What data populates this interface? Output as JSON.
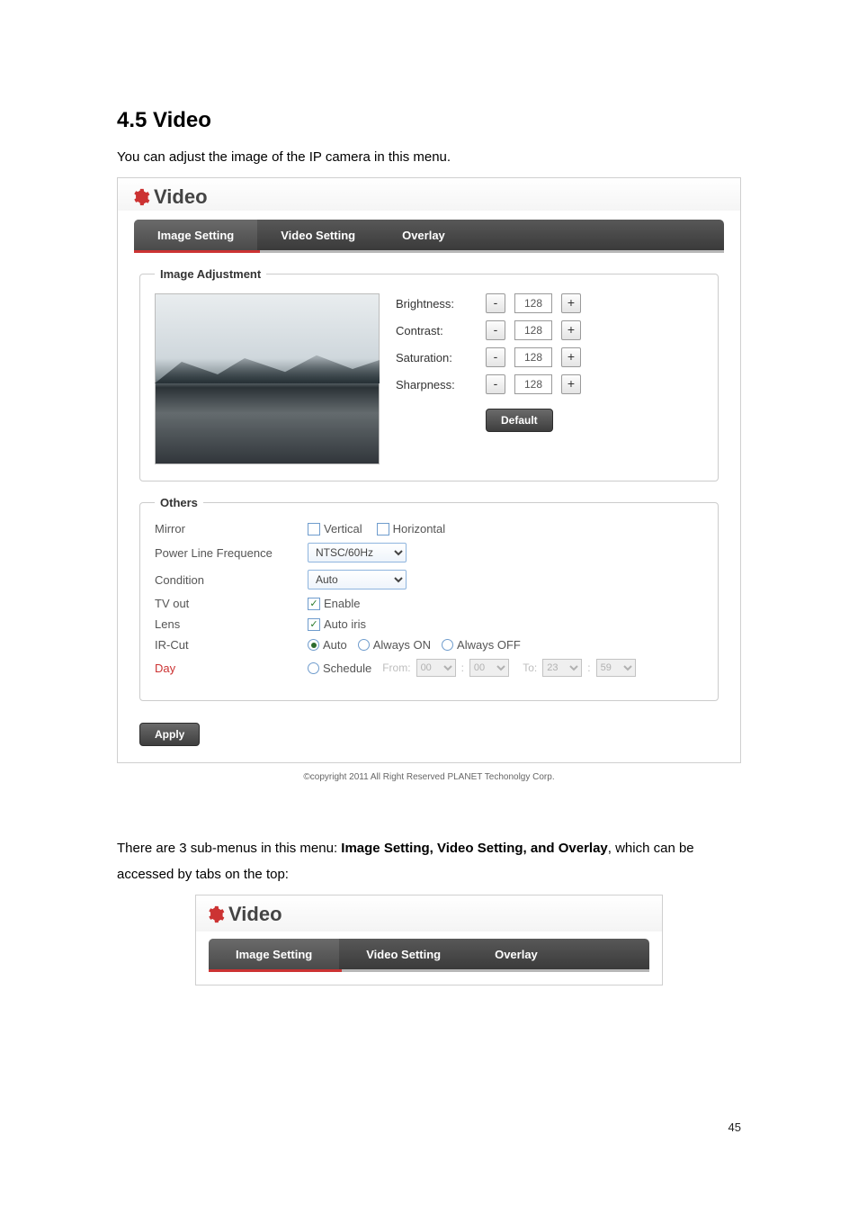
{
  "page": {
    "heading": "4.5 Video",
    "intro": "You can adjust the image of the IP camera in this menu.",
    "body_text_pre": "There are 3 sub-menus in this menu: ",
    "body_text_bold": "Image Setting, Video Setting, and Overlay",
    "body_text_post": ", which can be accessed by tabs on the top:",
    "page_number": "45",
    "copyright": "©copyright 2011 All Right Reserved PLANET Techonolgy Corp."
  },
  "video_panel": {
    "title": "Video",
    "tabs": [
      "Image Setting",
      "Video Setting",
      "Overlay"
    ],
    "active_tab": 0,
    "image_adjustment": {
      "legend": "Image Adjustment",
      "items": [
        {
          "label": "Brightness:",
          "value": "128"
        },
        {
          "label": "Contrast:",
          "value": "128"
        },
        {
          "label": "Saturation:",
          "value": "128"
        },
        {
          "label": "Sharpness:",
          "value": "128"
        }
      ],
      "default_btn": "Default"
    },
    "others": {
      "legend": "Others",
      "mirror": {
        "label": "Mirror",
        "vertical": "Vertical",
        "horizontal": "Horizontal",
        "v_checked": false,
        "h_checked": false
      },
      "plf": {
        "label": "Power Line Frequence",
        "value": "NTSC/60Hz"
      },
      "cond": {
        "label": "Condition",
        "value": "Auto"
      },
      "tvout": {
        "label": "TV out",
        "text": "Enable",
        "checked": true
      },
      "lens": {
        "label": "Lens",
        "text": "Auto iris",
        "checked": true
      },
      "ircut": {
        "label": "IR-Cut",
        "opts": [
          "Auto",
          "Always ON",
          "Always OFF"
        ],
        "selected": 0
      },
      "day": {
        "label": "Day",
        "schedule_word": "Schedule",
        "from_word": "From:",
        "to_word": "To:",
        "from_h": "00",
        "from_m": "00",
        "to_h": "23",
        "to_m": "59"
      }
    },
    "apply_btn": "Apply"
  }
}
